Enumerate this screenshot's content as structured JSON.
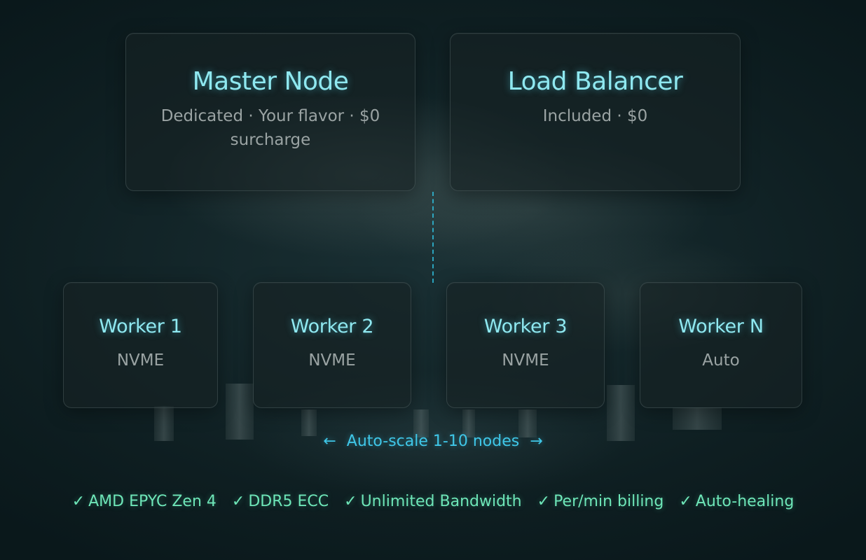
{
  "nodes": {
    "master": {
      "title": "Master Node",
      "subtitle": "Dedicated · Your flavor · $0 surcharge"
    },
    "load_balancer": {
      "title": "Load Balancer",
      "subtitle": "Included · $0"
    },
    "workers": [
      {
        "title": "Worker 1",
        "subtitle": "NVME"
      },
      {
        "title": "Worker 2",
        "subtitle": "NVME"
      },
      {
        "title": "Worker 3",
        "subtitle": "NVME"
      },
      {
        "title": "Worker N",
        "subtitle": "Auto"
      }
    ]
  },
  "autoscale": {
    "left_arrow": "←",
    "label": "Auto-scale 1-10 nodes",
    "right_arrow": "→"
  },
  "features": [
    {
      "check": "✓",
      "label": "AMD EPYC Zen 4"
    },
    {
      "check": "✓",
      "label": "DDR5 ECC"
    },
    {
      "check": "✓",
      "label": "Unlimited Bandwidth"
    },
    {
      "check": "✓",
      "label": "Per/min billing"
    },
    {
      "check": "✓",
      "label": "Auto-healing"
    }
  ],
  "colors": {
    "title_cyan": "#8fe8f0",
    "accent_blue": "#3fc7e8",
    "feature_green": "#6ee6b8",
    "background": "#0f2124"
  }
}
